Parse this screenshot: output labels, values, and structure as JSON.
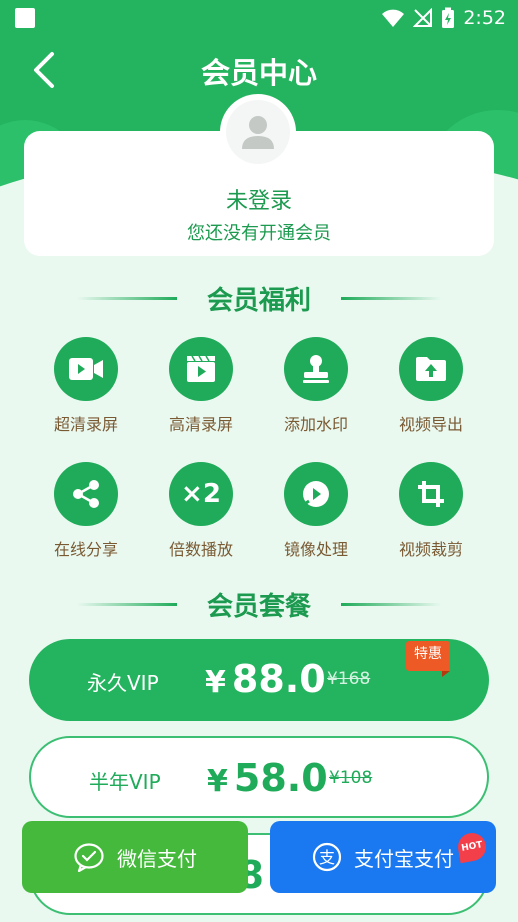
{
  "status": {
    "time": "2:52"
  },
  "nav": {
    "title": "会员中心"
  },
  "profile": {
    "login": "未登录",
    "subtitle": "您还没有开通会员"
  },
  "benefits_section": {
    "title": "会员福利"
  },
  "benefits": [
    {
      "label": "超清录屏",
      "icon": "video-camera-icon"
    },
    {
      "label": "高清录屏",
      "icon": "clapperboard-icon"
    },
    {
      "label": "添加水印",
      "icon": "stamp-icon"
    },
    {
      "label": "视频导出",
      "icon": "folder-upload-icon"
    },
    {
      "label": "在线分享",
      "icon": "share-icon"
    },
    {
      "label": "倍数播放",
      "icon": "speed-x2-icon"
    },
    {
      "label": "镜像处理",
      "icon": "mirror-icon"
    },
    {
      "label": "视频裁剪",
      "icon": "crop-icon"
    }
  ],
  "speed_icon_text": "×2",
  "plans_section": {
    "title": "会员套餐"
  },
  "plans": [
    {
      "name": "永久VIP",
      "currency": "¥",
      "price": "88.0",
      "original": "¥168",
      "tag": "特惠",
      "selected": true
    },
    {
      "name": "半年VIP",
      "currency": "¥",
      "price": "58.0",
      "original": "¥108",
      "selected": false
    },
    {
      "partial_price": "38"
    }
  ],
  "payment": {
    "wechat": "微信支付",
    "alipay": "支付宝支付",
    "hot_badge": "HOT",
    "alipay_symbol": "支"
  },
  "colors": {
    "primary": "#24b35f",
    "background": "#e9f9f0",
    "label_brown": "#7a5a33",
    "tag_orange": "#ee5a26",
    "wechat_green": "#44b93c",
    "alipay_blue": "#1a78f0"
  }
}
